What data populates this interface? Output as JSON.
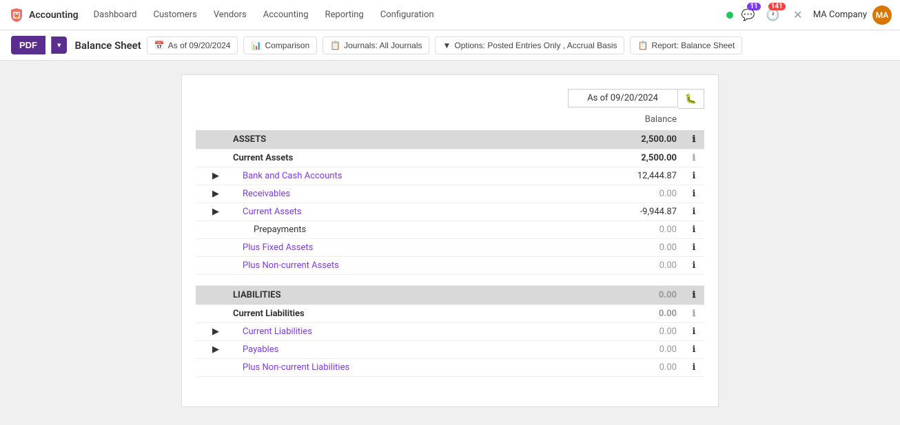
{
  "app": {
    "brand": "Accounting",
    "logo_symbol": "✕"
  },
  "nav": {
    "items": [
      {
        "label": "Dashboard",
        "active": false
      },
      {
        "label": "Customers",
        "active": false
      },
      {
        "label": "Vendors",
        "active": false
      },
      {
        "label": "Accounting",
        "active": false
      },
      {
        "label": "Reporting",
        "active": false
      },
      {
        "label": "Configuration",
        "active": false
      }
    ],
    "status": "online",
    "messages_count": "11",
    "activity_count": "141",
    "company": "MA Company"
  },
  "toolbar": {
    "pdf_label": "PDF",
    "page_title": "Balance Sheet",
    "filters": [
      {
        "icon": "📅",
        "label": "As of 09/20/2024"
      },
      {
        "icon": "📊",
        "label": "Comparison"
      },
      {
        "icon": "📋",
        "label": "Journals: All Journals"
      },
      {
        "icon": "▼",
        "label": "Options: Posted Entries Only , Accrual Basis"
      },
      {
        "icon": "📋",
        "label": "Report: Balance Sheet"
      }
    ]
  },
  "report": {
    "date_label": "As of 09/20/2024",
    "balance_col": "Balance",
    "sections": {
      "assets": {
        "label": "ASSETS",
        "total": "2,500.00",
        "rows": [
          {
            "label": "Current Assets",
            "amount": "2,500.00",
            "type": "group",
            "indent": 0
          },
          {
            "label": "Bank and Cash Accounts",
            "amount": "12,444.87",
            "type": "detail",
            "indent": 1,
            "expandable": true
          },
          {
            "label": "Receivables",
            "amount": "0.00",
            "type": "detail",
            "indent": 1,
            "expandable": true,
            "dimmed": true
          },
          {
            "label": "Current Assets",
            "amount": "-9,944.87",
            "type": "detail",
            "indent": 1,
            "expandable": true,
            "negative": true
          },
          {
            "label": "Prepayments",
            "amount": "0.00",
            "type": "detail",
            "indent": 2,
            "dimmed": true
          },
          {
            "label": "Plus Fixed Assets",
            "amount": "0.00",
            "type": "detail",
            "indent": 0,
            "link": true,
            "dimmed": true
          },
          {
            "label": "Plus Non-current Assets",
            "amount": "0.00",
            "type": "detail",
            "indent": 0,
            "link": true,
            "dimmed": true
          }
        ]
      },
      "liabilities": {
        "label": "LIABILITIES",
        "total": "0.00",
        "rows": [
          {
            "label": "Current Liabilities",
            "amount": "0.00",
            "type": "group",
            "indent": 0,
            "dimmed": true
          },
          {
            "label": "Current Liabilities",
            "amount": "0.00",
            "type": "detail",
            "indent": 1,
            "expandable": true,
            "dimmed": true
          },
          {
            "label": "Payables",
            "amount": "0.00",
            "type": "detail",
            "indent": 1,
            "expandable": true,
            "dimmed": true
          },
          {
            "label": "Plus Non-current Liabilities",
            "amount": "0.00",
            "type": "detail",
            "indent": 0,
            "link": true,
            "dimmed": true
          }
        ]
      }
    }
  }
}
